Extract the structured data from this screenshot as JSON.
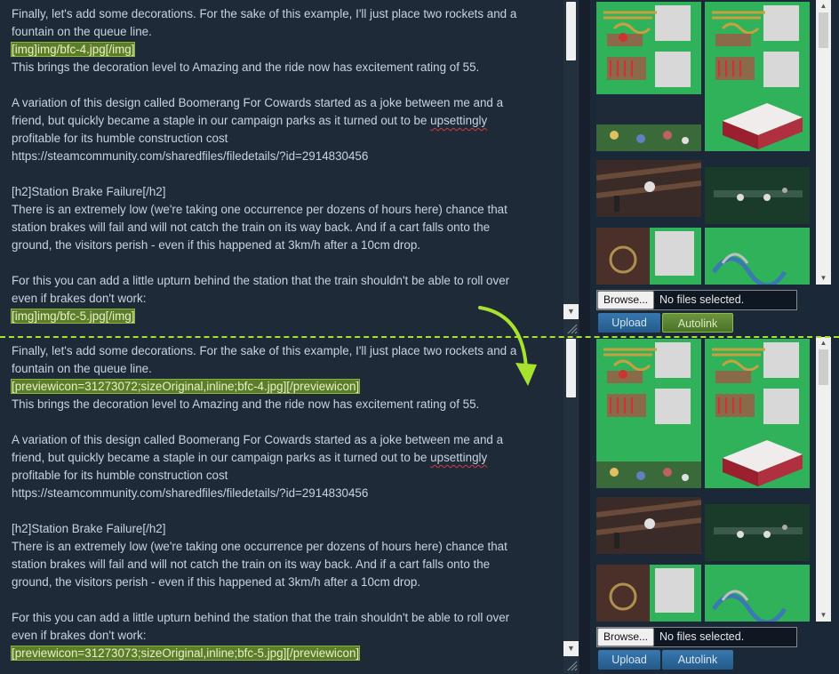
{
  "top": {
    "paragraphs": [
      [
        "Finally, let's add some decorations. For the sake of this example, I'll just place two rockets and a",
        "fountain on the queue line."
      ],
      [
        "[img]img/bfc-4.jpg[/img]"
      ],
      [
        "This brings the decoration level to Amazing and the ride now has excitement rating of 55."
      ],
      [
        ""
      ],
      [
        "A variation of this design called Boomerang For Cowards started as a joke between me and a",
        "friend, but quickly became a staple in our campaign parks as it turned out to be ",
        "upsettingly",
        "profitable for its humble construction cost",
        "https://steamcommunity.com/sharedfiles/filedetails/?id=2914830456"
      ],
      [
        ""
      ],
      [
        "[h2]Station Brake Failure[/h2]",
        "There is an extremely low (we're taking one occurrence per dozens of hours here) chance that",
        "station brakes will fail and will not catch the train on its way back. And if a cart falls onto the",
        "ground, the visitors perish - even if this happened at 3km/h after a 10cm drop."
      ],
      [
        ""
      ],
      [
        "For this you can add a little upturn behind the station that the train shouldn't be able to roll over",
        "even if brakes don't work:"
      ],
      [
        "[img]img/bfc-5.jpg[/img]"
      ]
    ],
    "file_label": "No files selected.",
    "browse_label": "Browse...",
    "upload_label": "Upload",
    "autolink_label": "Autolink"
  },
  "bottom": {
    "tag1": "[previewicon=31273072;sizeOriginal,inline;bfc-4.jpg][/previewicon]",
    "tag2": "[previewicon=31273073;sizeOriginal,inline;bfc-5.jpg][/previewicon]",
    "file_label": "No files selected.",
    "browse_label": "Browse...",
    "upload_label": "Upload",
    "autolink_label": "Autolink"
  },
  "text": {
    "l1": "Finally, let's add some decorations. For the sake of this example, I'll just place two rockets and a",
    "l2": "fountain on the queue line.",
    "img1": "[img]img/bfc-4.jpg[/img]",
    "l3": "This brings the decoration level to Amazing and the ride now has excitement rating of 55.",
    "l4": "A variation of this design called Boomerang For Cowards started as a joke between me and a",
    "l5a": "friend, but quickly became a staple in our campaign parks as it turned out to be ",
    "l5b": "upsettingly",
    "l6": "profitable for its humble construction cost",
    "l7": "https://steamcommunity.com/sharedfiles/filedetails/?id=2914830456",
    "l8": "[h2]Station Brake Failure[/h2]",
    "l9": "There is an extremely low (we're taking one occurrence per dozens of hours here) chance that",
    "l10": "station brakes will fail and will not catch the train on its way back. And if a cart falls onto the",
    "l11": "ground, the visitors perish - even if this happened at 3km/h after a 10cm drop.",
    "l12": "For this you can add a little upturn behind the station that the train shouldn't be able to roll over",
    "l13": "even if brakes don't work:",
    "img2": "[img]img/bfc-5.jpg[/img]"
  },
  "colors": {
    "background": "#1b2838",
    "highlight": "#5c7d2a",
    "divider": "#a6e22e",
    "button": "#2d6a9f"
  }
}
